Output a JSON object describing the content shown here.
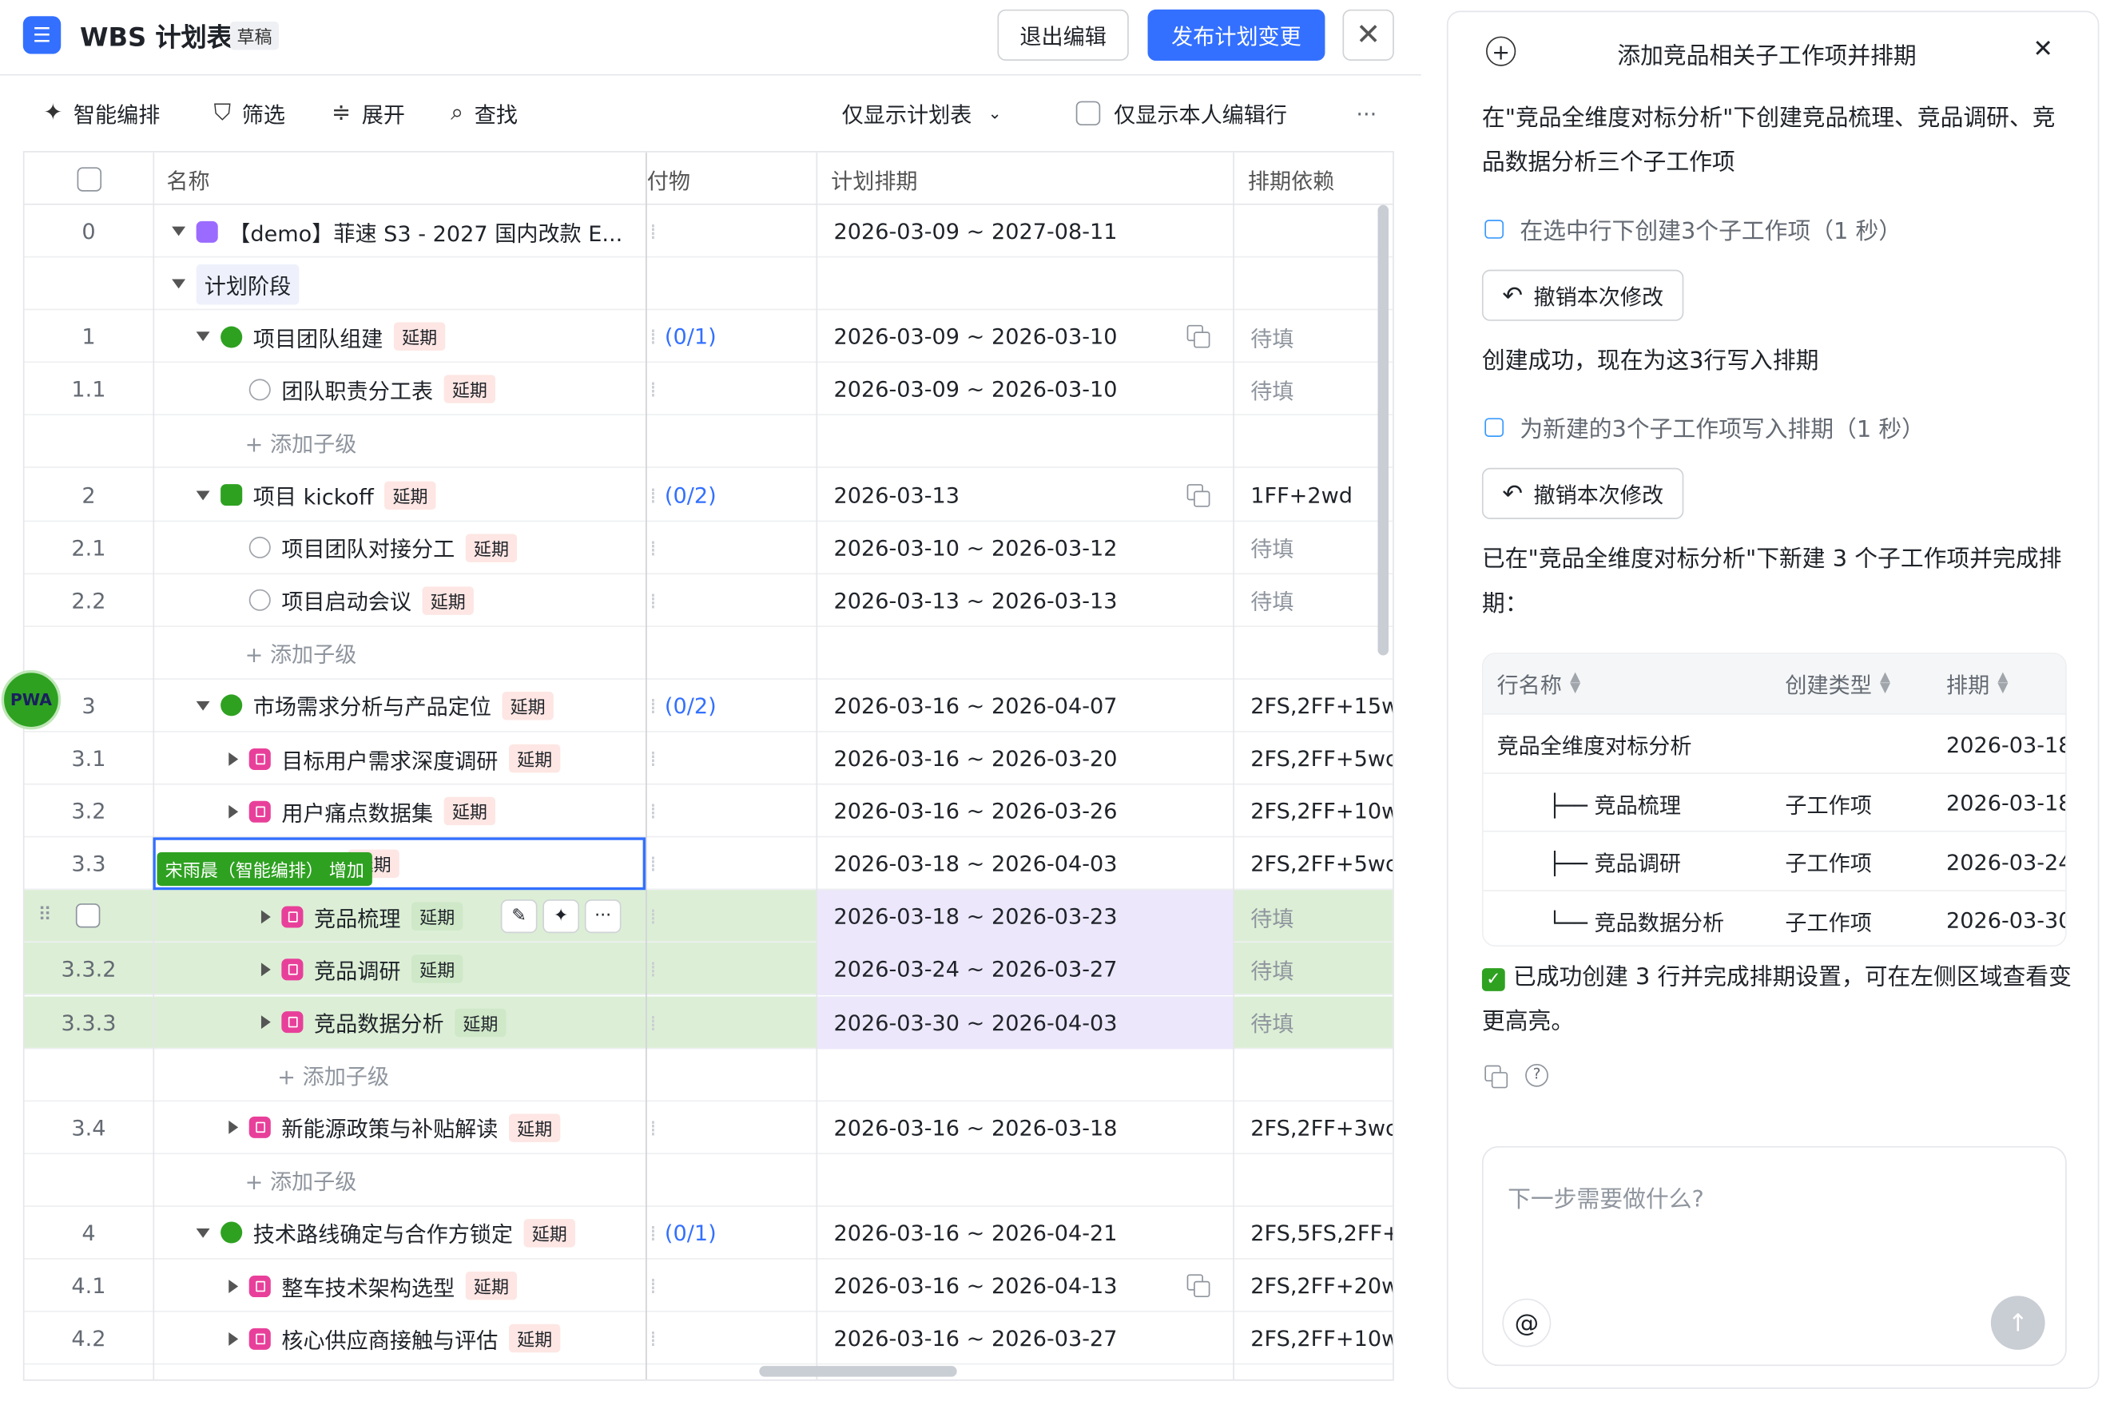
{
  "header": {
    "title": "WBS 计划表",
    "draft_label": "草稿",
    "exit_label": "退出编辑",
    "publish_label": "发布计划变更",
    "close_glyph": "✕"
  },
  "toolbar": {
    "smart": "智能编排",
    "filter": "筛选",
    "expand": "展开",
    "find": "查找",
    "view_select": "仅显示计划表",
    "only_mine": "仅显示本人编辑行",
    "more": "···"
  },
  "table": {
    "headers": {
      "name": "名称",
      "deliv": "付物",
      "sched": "计划排期",
      "dep": "排期依赖"
    },
    "rows": [
      {
        "num": "0",
        "name": "【demo】菲速 S3 - 2027 国内改款 E...",
        "sched": "2026-03-09 ~ 2027-08-11",
        "dep": ""
      },
      {
        "num": "",
        "name": "计划阶段"
      },
      {
        "num": "1",
        "name": "项目团队组建",
        "tag": "延期",
        "deliv": "(0/1)",
        "sched": "2026-03-09 ~ 2026-03-10",
        "dep": "待填"
      },
      {
        "num": "1.1",
        "name": "团队职责分工表",
        "tag": "延期",
        "sched": "2026-03-09 ~ 2026-03-10",
        "dep": "待填"
      },
      {
        "num": "",
        "add": "+ 添加子级"
      },
      {
        "num": "2",
        "name": "项目 kickoff",
        "tag": "延期",
        "deliv": "(0/2)",
        "sched": "2026-03-13",
        "dep": "1FF+2wd"
      },
      {
        "num": "2.1",
        "name": "项目团队对接分工",
        "tag": "延期",
        "sched": "2026-03-10 ~ 2026-03-12",
        "dep": "待填"
      },
      {
        "num": "2.2",
        "name": "项目启动会议",
        "tag": "延期",
        "sched": "2026-03-13 ~ 2026-03-13",
        "dep": "待填"
      },
      {
        "num": "",
        "add": "+ 添加子级"
      },
      {
        "num": "3",
        "name": "市场需求分析与产品定位",
        "tag": "延期",
        "deliv": "(0/2)",
        "sched": "2026-03-16 ~ 2026-04-07",
        "dep": "2FS,2FF+15w"
      },
      {
        "num": "3.1",
        "name": "目标用户需求深度调研",
        "tag": "延期",
        "sched": "2026-03-16 ~ 2026-03-20",
        "dep": "2FS,2FF+5wc"
      },
      {
        "num": "3.2",
        "name": "用户痛点数据集",
        "tag": "延期",
        "sched": "2026-03-16 ~ 2026-03-26",
        "dep": "2FS,2FF+10w"
      },
      {
        "num": "3.3",
        "name": "度对标分析",
        "tag": "延期",
        "sched": "2026-03-18 ~ 2026-04-03",
        "dep": "2FS,2FF+5wc"
      },
      {
        "num": "",
        "name": "竞品梳理",
        "tag": "延期",
        "sched": "2026-03-18 ~ 2026-03-23",
        "dep": "待填"
      },
      {
        "num": "3.3.2",
        "name": "竞品调研",
        "tag": "延期",
        "sched": "2026-03-24 ~ 2026-03-27",
        "dep": "待填"
      },
      {
        "num": "3.3.3",
        "name": "竞品数据分析",
        "tag": "延期",
        "sched": "2026-03-30 ~ 2026-04-03",
        "dep": "待填"
      },
      {
        "num": "",
        "add": "+ 添加子级"
      },
      {
        "num": "3.4",
        "name": "新能源政策与补贴解读",
        "tag": "延期",
        "sched": "2026-03-16 ~ 2026-03-18",
        "dep": "2FS,2FF+3wc"
      },
      {
        "num": "",
        "add": "+ 添加子级"
      },
      {
        "num": "4",
        "name": "技术路线确定与合作方锁定",
        "tag": "延期",
        "deliv": "(0/1)",
        "sched": "2026-03-16 ~ 2026-04-21",
        "dep": "2FS,5FS,2FF+"
      },
      {
        "num": "4.1",
        "name": "整车技术架构选型",
        "tag": "延期",
        "sched": "2026-03-16 ~ 2026-04-13",
        "dep": "2FS,2FF+20w"
      },
      {
        "num": "4.2",
        "name": "核心供应商接触与评估",
        "tag": "延期",
        "sched": "2026-03-16 ~ 2026-03-27",
        "dep": "2FS,2FF+10w"
      }
    ],
    "editor_badge": "宋雨晨（智能编排） 增加",
    "avatar_text": "PWA"
  },
  "panel": {
    "title": "添加竞品相关子工作项并排期",
    "user_msg": "在\"竞品全维度对标分析\"下创建竞品梳理、竞品调研、竞品数据分析三个子工作项",
    "step1": "在选中行下创建3个子工作项（1 秒）",
    "undo": "撤销本次修改",
    "msg2": "创建成功，现在为这3行写入排期",
    "step2": "为新建的3个子工作项写入排期（1 秒）",
    "summary": "已在\"竞品全维度对标分析\"下新建 3 个子工作项并完成排期：",
    "rtable": {
      "headers": [
        "行名称",
        "创建类型",
        "排期"
      ],
      "rows": [
        {
          "name": "竞品全维度对标分析",
          "type": "",
          "date": "2026-03-18"
        },
        {
          "name": "├── 竞品梳理",
          "type": "子工作项",
          "date": "2026-03-18"
        },
        {
          "name": "├── 竞品调研",
          "type": "子工作项",
          "date": "2026-03-24"
        },
        {
          "name": "└── 竞品数据分析",
          "type": "子工作项",
          "date": "2026-03-30"
        }
      ]
    },
    "done_msg": "已成功创建 3 行并完成排期设置，可在左侧区域查看变更高亮。",
    "input_placeholder": "下一步需要做什么?"
  },
  "colors": {
    "accent": "#3370ff",
    "highlight": "#dcefd6",
    "delay_tag": "#fde6e3"
  }
}
